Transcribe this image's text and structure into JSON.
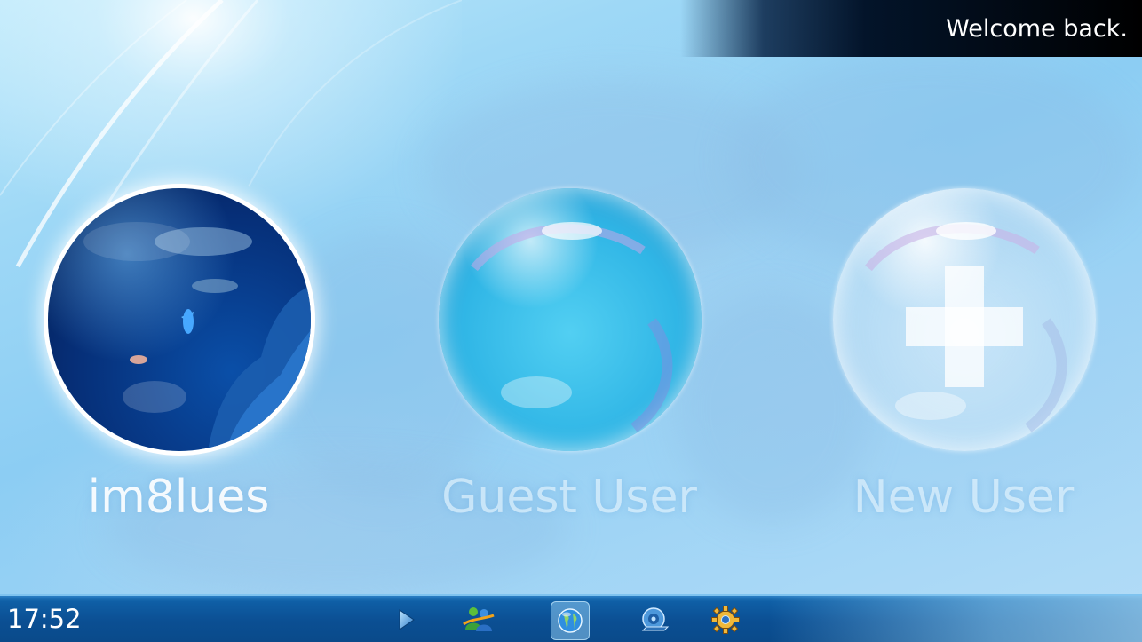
{
  "header": {
    "welcome_text": "Welcome back."
  },
  "users": [
    {
      "name": "im8lues",
      "selected": true
    },
    {
      "name": "Guest User",
      "selected": false
    },
    {
      "name": "New User",
      "selected": false
    }
  ],
  "taskbar": {
    "clock": "17:52",
    "buttons": [
      {
        "icon": "play-icon"
      },
      {
        "icon": "messenger-icon"
      },
      {
        "icon": "globe-icon",
        "active": true
      },
      {
        "icon": "speaker-icon"
      },
      {
        "icon": "gear-icon"
      }
    ]
  },
  "colors": {
    "accent": "#0b4f93",
    "taskbar_highlight": "#7fc3ef",
    "banner": "#000000"
  }
}
